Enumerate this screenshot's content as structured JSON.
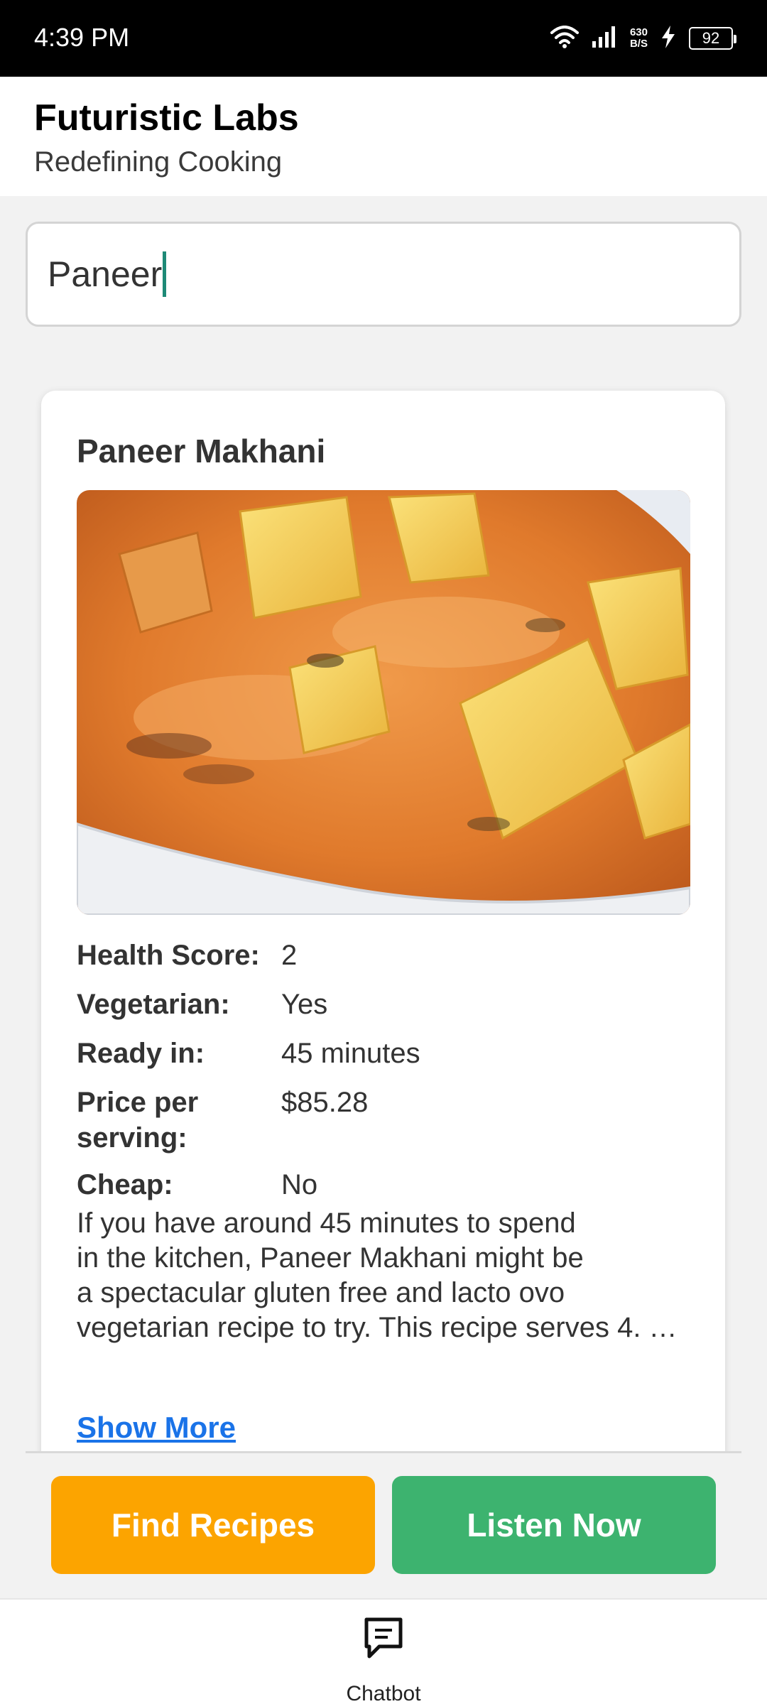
{
  "status_bar": {
    "time": "4:39 PM",
    "net_speed_value": "630",
    "net_speed_unit": "B/S",
    "battery": "92",
    "icons": [
      "wifi-icon",
      "signal-icon",
      "charging-icon",
      "battery-icon"
    ]
  },
  "header": {
    "title": "Futuristic Labs",
    "subtitle": "Redefining Cooking"
  },
  "search": {
    "value": "Paneer",
    "placeholder": ""
  },
  "recipe": {
    "title": "Paneer Makhani",
    "image_icon": "curry-photo",
    "details": [
      {
        "label": "Health Score:",
        "value": "2"
      },
      {
        "label": "Vegetarian:",
        "value": "Yes"
      },
      {
        "label": "Ready in:",
        "value": "45 minutes"
      },
      {
        "label": "Price per serving:",
        "value": "$85.28"
      },
      {
        "label": "Cheap:",
        "value": "No"
      }
    ],
    "description": "If you have around 45 minutes to spend\nin the kitchen, Paneer Makhani might be\na spectacular gluten free and lacto ovo\nvegetarian recipe to try. This recipe serves 4. …",
    "show_more_label": "Show More"
  },
  "actions": {
    "find_label": "Find Recipes",
    "listen_label": "Listen Now",
    "find_color": "#fca400",
    "listen_color": "#3db36f"
  },
  "bottom_nav": {
    "items": [
      {
        "label": "Chatbot",
        "icon": "chat-icon"
      }
    ]
  }
}
